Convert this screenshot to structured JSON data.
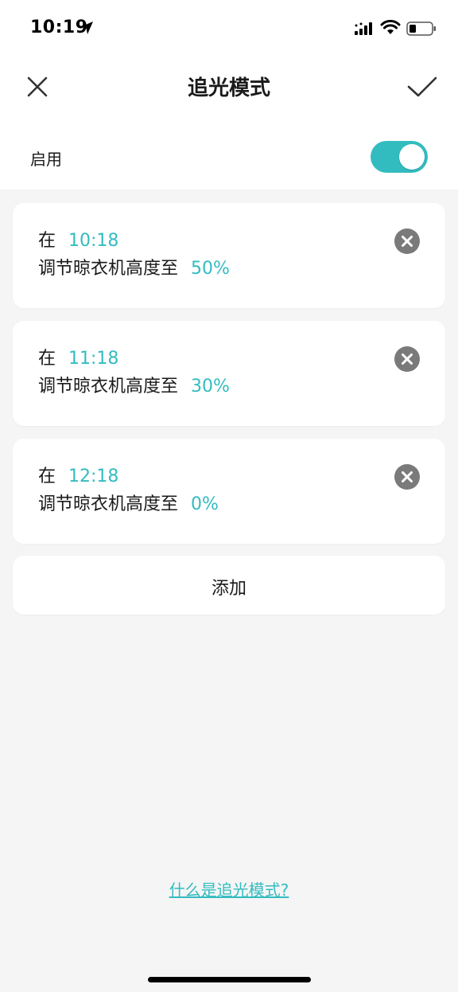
{
  "status_bar": {
    "time": "10:19",
    "icons": [
      "location-arrow-icon",
      "signal-icon",
      "wifi-icon",
      "battery-icon"
    ]
  },
  "nav": {
    "title": "追光模式",
    "close_icon": "close-icon",
    "confirm_icon": "check-icon"
  },
  "enable": {
    "label": "启用",
    "enabled": true
  },
  "schedules": [
    {
      "prefix": "在",
      "time": "10:18",
      "action": "调节晾衣机高度至",
      "height": "50%"
    },
    {
      "prefix": "在",
      "time": "11:18",
      "action": "调节晾衣机高度至",
      "height": "30%"
    },
    {
      "prefix": "在",
      "time": "12:18",
      "action": "调节晾衣机高度至",
      "height": "0%"
    }
  ],
  "add_label": "添加",
  "help_link": "什么是追光模式?",
  "colors": {
    "accent": "#33bcc0",
    "background": "#f5f5f5",
    "card": "#ffffff",
    "remove_icon": "#7a7a7a"
  }
}
